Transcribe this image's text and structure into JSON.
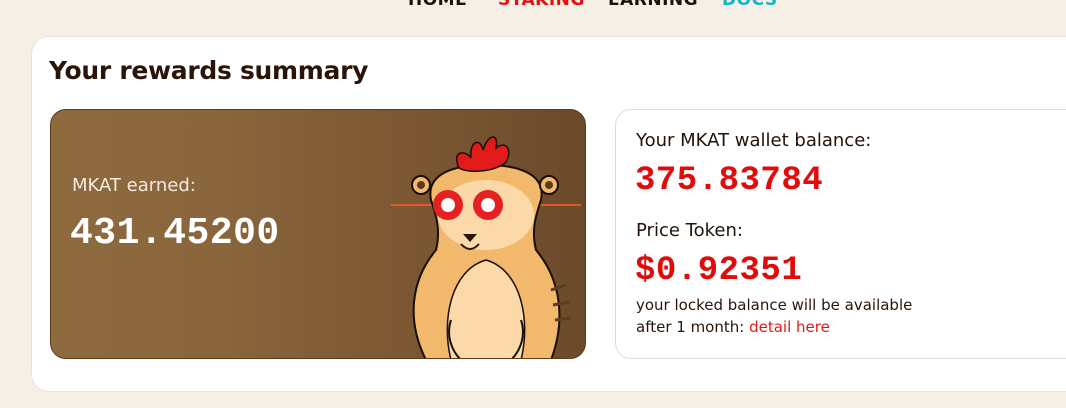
{
  "nav": {
    "items": [
      {
        "label": "HOME",
        "color": "#1e1208"
      },
      {
        "label": "STAKING",
        "color": "#e60f0f"
      },
      {
        "label": "EARNING",
        "color": "#1e1208"
      },
      {
        "label": "DOCS",
        "color": "#14b4c8"
      }
    ]
  },
  "summary": {
    "title": "Your rewards summary"
  },
  "earned": {
    "label": "MKAT earned:",
    "value": "431.45200",
    "mascot_icon": "meerkat-mascot-laser-eyes"
  },
  "balance": {
    "label": "Your MKAT wallet balance:",
    "value": "375.83784",
    "price_label": "Price Token:",
    "price_value": "$0.92351",
    "note_line1": "your locked balance will be available",
    "note_line2": "after 1 month: ",
    "detail_link": "detail here"
  },
  "colors": {
    "accent_red": "#e30a0a",
    "card_brown": "#8a663c",
    "background": "#f6efe6"
  }
}
